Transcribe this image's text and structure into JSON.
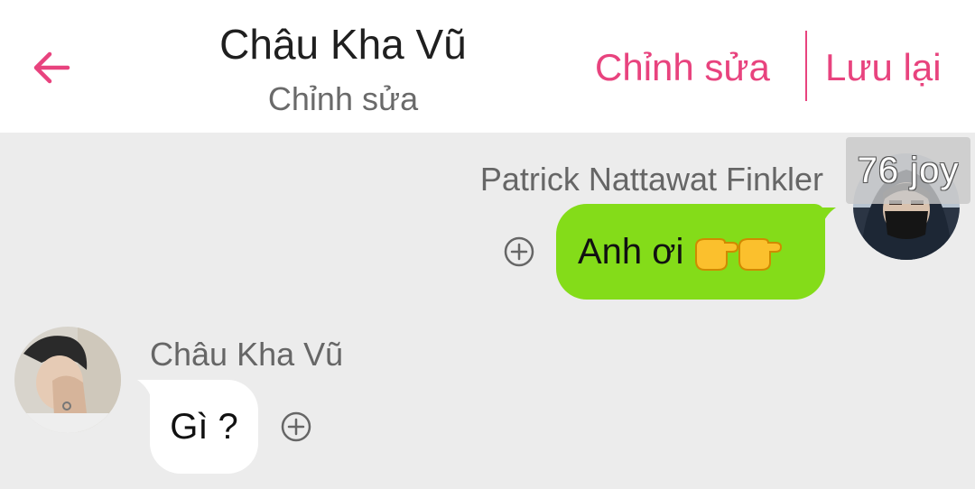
{
  "header": {
    "title": "Châu Kha Vũ",
    "subtitle": "Chỉnh sửa",
    "edit_label": "Chỉnh sửa",
    "save_label": "Lưu lại",
    "accent_color": "#e8437e"
  },
  "messages": [
    {
      "sender": "Patrick Nattawat Finkler",
      "text": "Anh ơi",
      "emoji": "👉👉",
      "side": "right",
      "bubble_color": "#84dc19",
      "badge": "76 joy"
    },
    {
      "sender": "Châu Kha Vũ",
      "text": "Gì ?",
      "side": "left",
      "bubble_color": "#ffffff"
    }
  ],
  "icons": {
    "back": "arrow-left-icon",
    "add_reaction": "plus-circle-icon",
    "emoji": "pointing-right-emoji"
  }
}
